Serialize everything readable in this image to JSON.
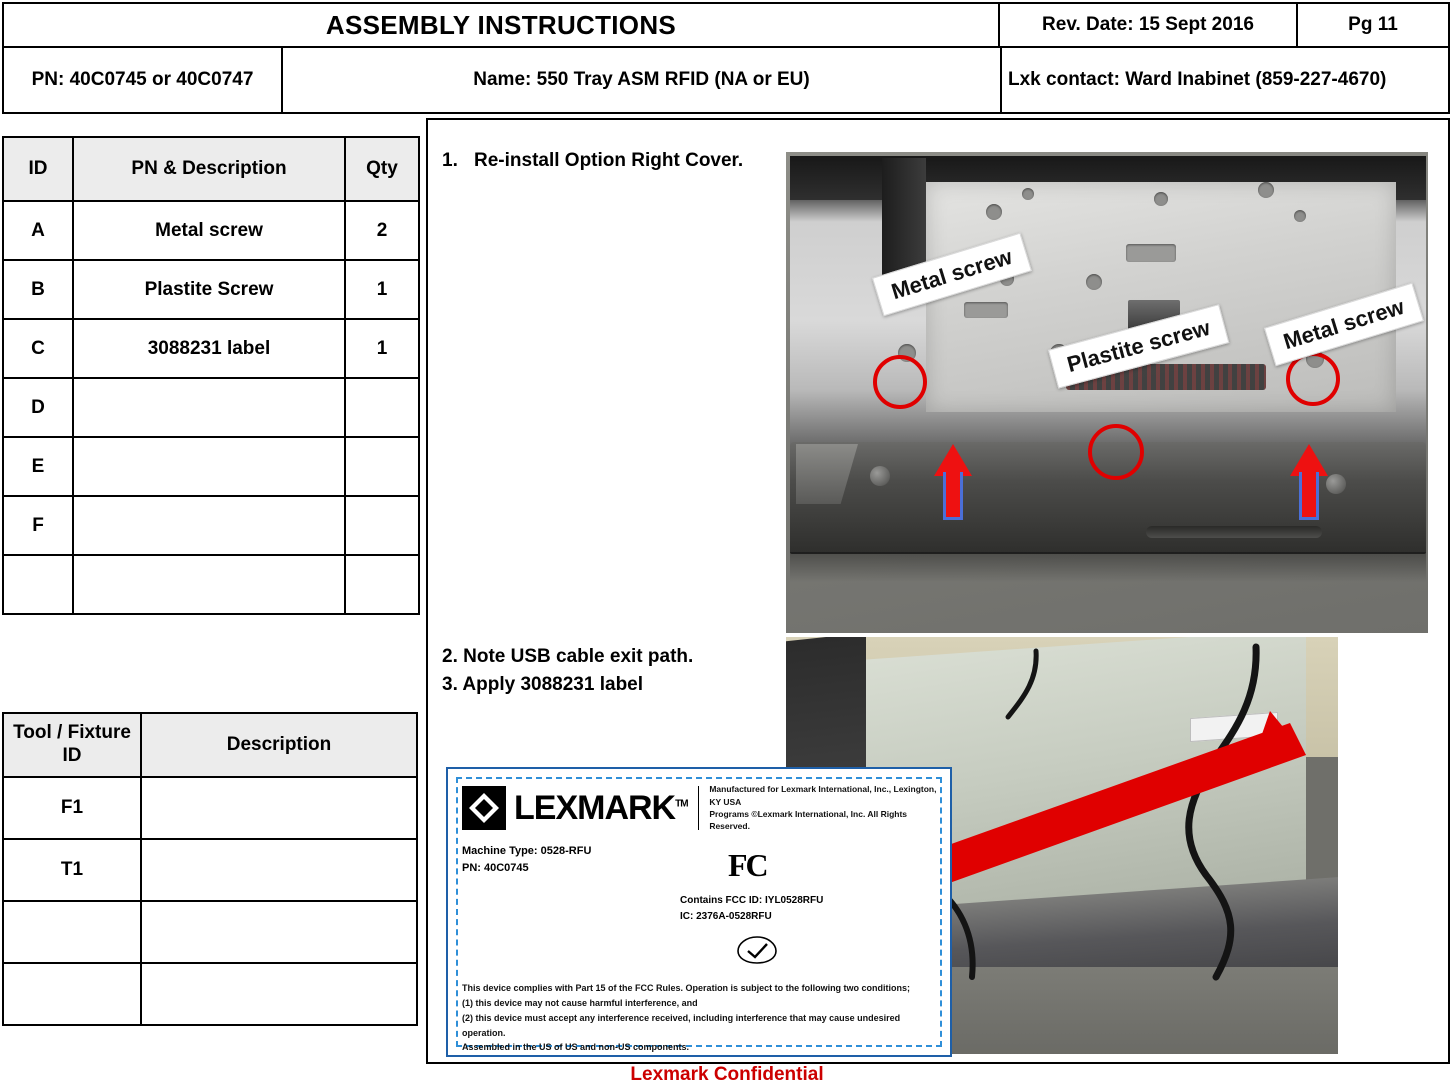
{
  "header": {
    "title": "ASSEMBLY INSTRUCTIONS",
    "rev_date": "Rev. Date: 15 Sept 2016",
    "page": "Pg  11",
    "pn": "PN:  40C0745 or 40C0747",
    "name": "Name:  550 Tray ASM RFID (NA or EU)",
    "contact": "Lxk contact: Ward Inabinet (859-227-4670)"
  },
  "parts_table": {
    "headers": [
      "ID",
      "PN & Description",
      "Qty"
    ],
    "rows": [
      {
        "id": "A",
        "desc": "Metal screw",
        "qty": "2"
      },
      {
        "id": "B",
        "desc": "Plastite Screw",
        "qty": "1"
      },
      {
        "id": "C",
        "desc": "3088231 label",
        "qty": "1"
      },
      {
        "id": "D",
        "desc": "",
        "qty": ""
      },
      {
        "id": "E",
        "desc": "",
        "qty": ""
      },
      {
        "id": "F",
        "desc": "",
        "qty": ""
      },
      {
        "id": "",
        "desc": "",
        "qty": ""
      }
    ]
  },
  "tool_table": {
    "headers": [
      "Tool / Fixture ID",
      "Description"
    ],
    "rows": [
      {
        "id": "F1",
        "desc": ""
      },
      {
        "id": "T1",
        "desc": ""
      },
      {
        "id": "",
        "desc": ""
      },
      {
        "id": "",
        "desc": ""
      }
    ]
  },
  "steps": {
    "step1_num": "1.",
    "step1_text": "Re-install Option Right Cover.",
    "step2_text": "2. Note USB cable exit path.",
    "step3_text": "3. Apply 3088231 label"
  },
  "photo1_callouts": {
    "metal_screw_left": "Metal screw",
    "plastite_screw": "Plastite screw",
    "metal_screw_right": "Metal screw"
  },
  "lexmark_label": {
    "brand": "LEXMARK",
    "trademark": "TM",
    "manufactured": "Manufactured for Lexmark International, Inc., Lexington, KY USA\nPrograms ©Lexmark International, Inc. All Rights Reserved.",
    "machine_type": "Machine Type: 0528-RFU",
    "pn": "PN: 40C0745",
    "fcc_logo": "FC",
    "fcc_id": "Contains FCC ID: IYL0528RFU",
    "ic_id": "IC: 2376A-0528RFU",
    "compliance": "This device complies with Part 15 of the FCC Rules. Operation is subject to the following two conditions;\n(1) this device may not cause harmful interference, and\n(2) this device must accept any interference received, including interference that may cause undesired operation.\nAssembled in the US of US and non-US components."
  },
  "footer": {
    "confidential": "Lexmark Confidential"
  },
  "colors": {
    "accent_red": "#cc0000",
    "arrow_red": "#ee1111",
    "label_blue": "#2f8fd8",
    "header_gray": "#ececec"
  }
}
